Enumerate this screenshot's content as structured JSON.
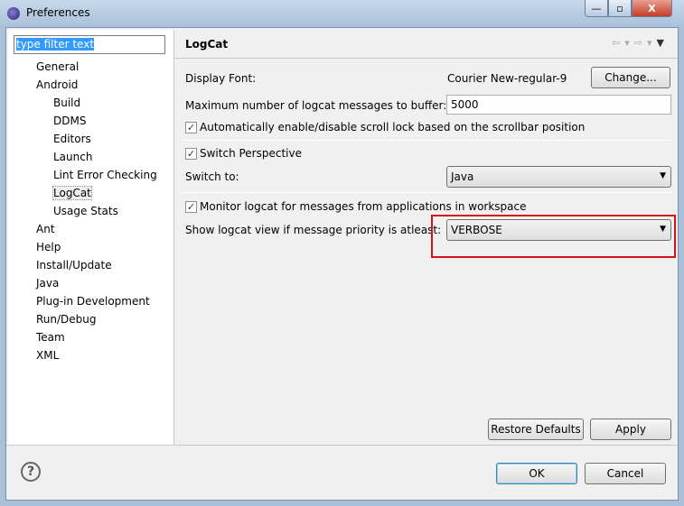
{
  "window": {
    "title": "Preferences",
    "minimize": "—",
    "maximize": "▫",
    "close": "X"
  },
  "sidebar": {
    "filter_value": "type filter text",
    "items": [
      {
        "label": "General",
        "level": 1
      },
      {
        "label": "Android",
        "level": 1
      },
      {
        "label": "Build",
        "level": 2
      },
      {
        "label": "DDMS",
        "level": 2
      },
      {
        "label": "Editors",
        "level": 2
      },
      {
        "label": "Launch",
        "level": 2
      },
      {
        "label": "Lint Error Checking",
        "level": 2
      },
      {
        "label": "LogCat",
        "level": 2,
        "selected": true
      },
      {
        "label": "Usage Stats",
        "level": 2
      },
      {
        "label": "Ant",
        "level": 1
      },
      {
        "label": "Help",
        "level": 1
      },
      {
        "label": "Install/Update",
        "level": 1
      },
      {
        "label": "Java",
        "level": 1
      },
      {
        "label": "Plug-in Development",
        "level": 1
      },
      {
        "label": "Run/Debug",
        "level": 1
      },
      {
        "label": "Team",
        "level": 1
      },
      {
        "label": "XML",
        "level": 1
      }
    ]
  },
  "page": {
    "title": "LogCat",
    "display_font_label": "Display Font:",
    "display_font_value": "Courier New-regular-9",
    "change_button": "Change...",
    "max_messages_label": "Maximum number of logcat messages to buffer:",
    "max_messages_value": "5000",
    "scroll_lock_label": "Automatically enable/disable scroll lock based on the scrollbar position",
    "scroll_lock_checked": true,
    "switch_perspective_label": "Switch Perspective",
    "switch_perspective_checked": true,
    "switch_to_label": "Switch to:",
    "switch_to_value": "Java",
    "monitor_label": "Monitor logcat for messages from applications in workspace",
    "monitor_checked": true,
    "priority_label": "Show logcat view if message priority is atleast:",
    "priority_value": "VERBOSE",
    "restore_defaults": "Restore Defaults",
    "apply": "Apply"
  },
  "footer": {
    "ok": "OK",
    "cancel": "Cancel",
    "help": "?"
  },
  "colors": {
    "highlight": "#d0141a",
    "selection": "#3399ff"
  }
}
